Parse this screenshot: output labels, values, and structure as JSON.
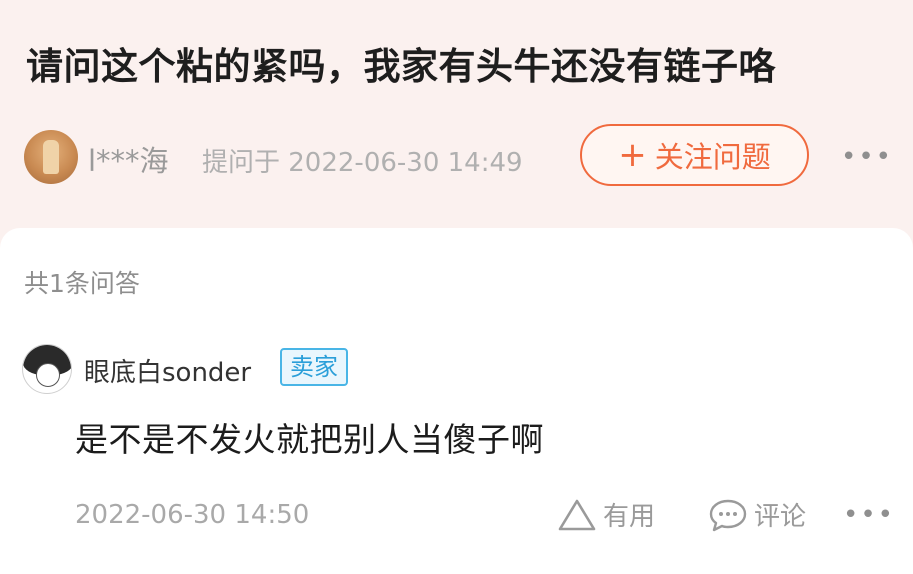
{
  "question": {
    "title": "请问这个粘的紧吗，我家有头牛还没有链子咯",
    "asker_name": "l***海",
    "asked_label": "提问于 2022-06-30 14:49",
    "follow_button_label": "关注问题",
    "follow_icon": "plus-icon",
    "more_icon": "more-dots-icon",
    "more_glyph": "•••"
  },
  "answers": {
    "count_label": "共1条问答",
    "items": [
      {
        "author": "眼底白sonder",
        "badge": "卖家",
        "text": "是不是不发火就把别人当傻子啊",
        "time": "2022-06-30 14:50",
        "useful_label": "有用",
        "comment_label": "评论",
        "more_glyph": "•••"
      }
    ]
  },
  "colors": {
    "accent": "#f06a3e",
    "seller_badge": "#2b9fd9",
    "header_bg": "#fbf1ef"
  }
}
